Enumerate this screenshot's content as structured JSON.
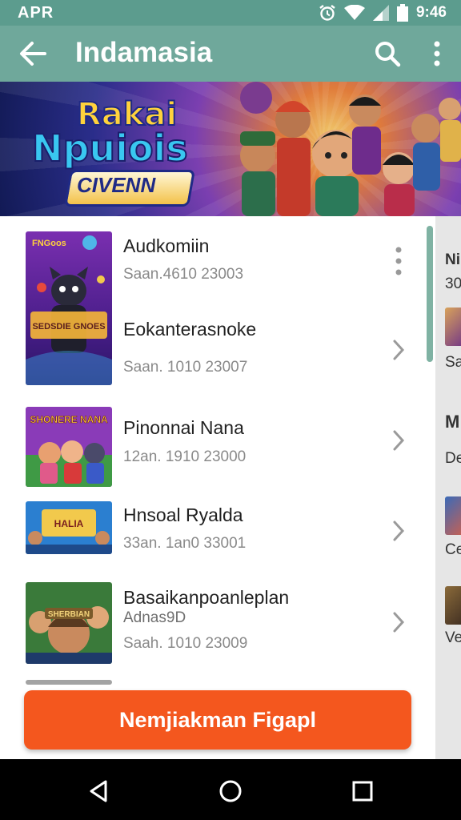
{
  "status_bar": {
    "carrier": "APR",
    "time": "9:46"
  },
  "app_bar": {
    "title": "Indamasia"
  },
  "banner": {
    "logo_line1": "Rakai",
    "logo_line2": "Npuiois",
    "logo_line3": "CIVENN"
  },
  "list": {
    "items": [
      {
        "title": "Audkomiin",
        "subtitle": "Saan.4610 23003",
        "thumb_caption": "FNGoos",
        "thumb_label": "SEDSDIE GNOES",
        "action_icon": "more-vert-icon"
      },
      {
        "title": "Eokanterasnoke",
        "subtitle": "Saan. 1010 23007",
        "action_icon": "chevron-right-icon"
      },
      {
        "title": "Pinonnai Nana",
        "subtitle": "12an. 1910 23000",
        "thumb_label": "SHONERE NANA",
        "action_icon": "chevron-right-icon"
      },
      {
        "title": "Hnsoal Ryalda",
        "subtitle": "33an. 1an0 33001",
        "thumb_label": "HALIA",
        "action_icon": "chevron-right-icon"
      },
      {
        "title": "Basaikanpoanleplan",
        "subtitle2": "Adnas9D",
        "subtitle": "Saah. 1010 23009",
        "thumb_label": "SHERBIAN",
        "action_icon": "chevron-right-icon"
      }
    ]
  },
  "side_panel": {
    "texts": [
      "Ni",
      "30",
      "Sa",
      "M",
      "De",
      "Ce",
      "Ve"
    ]
  },
  "cta": {
    "label": "Nemjiakman Figapl"
  },
  "colors": {
    "primary": "#6fa89b",
    "status": "#5c9c8e",
    "accent": "#f4571e",
    "scroll": "#7fb2a3"
  }
}
